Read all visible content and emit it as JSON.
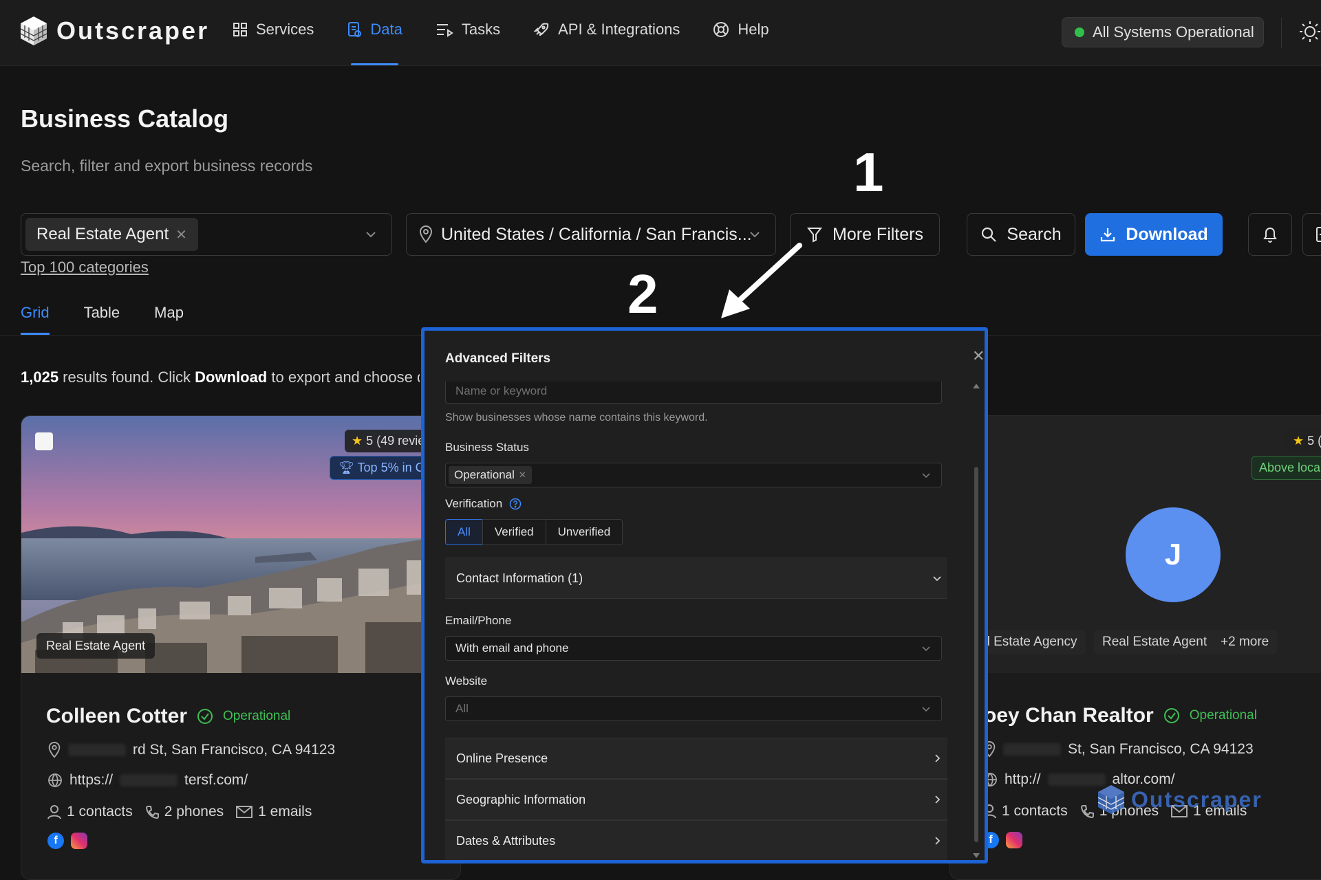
{
  "nav": {
    "brand": "Outscraper",
    "items": [
      {
        "label": "Services",
        "icon": "grid-icon"
      },
      {
        "label": "Data",
        "icon": "database-doc-icon",
        "active": true
      },
      {
        "label": "Tasks",
        "icon": "tasks-list-icon"
      },
      {
        "label": "API & Integrations",
        "icon": "rocket-icon"
      },
      {
        "label": "Help",
        "icon": "lifebuoy-icon"
      }
    ],
    "status": "All Systems Operational",
    "status_color": "#2fbf4a"
  },
  "header": {
    "title": "Business Catalog",
    "subtitle": "Search, filter and export business records"
  },
  "annotations": {
    "step1": "1",
    "step2": "2"
  },
  "filters": {
    "category_chip": "Real Estate Agent",
    "location": "United States / California / San Francis...",
    "more_filters": "More Filters",
    "search": "Search",
    "download": "Download",
    "top_categories": "Top 100 categories"
  },
  "tabs": [
    {
      "label": "Grid",
      "active": true
    },
    {
      "label": "Table"
    },
    {
      "label": "Map"
    }
  ],
  "results": {
    "count": "1,025",
    "text_a": " results found. Click ",
    "bold": "Download",
    "text_b": " to export and choose qu"
  },
  "cards": [
    {
      "rating": "5 (49 revie",
      "top_badge": "Top 5% in C",
      "image_tag": "Real Estate Agent",
      "name": "Colleen Cotter",
      "status": "Operational",
      "address": "rd St, San Francisco, CA 94123",
      "website_a": "https://",
      "website_b": "tersf.com/",
      "contacts": "1 contacts",
      "phones": "2 phones",
      "emails": "1 emails"
    },
    {
      "rating": "5 (",
      "top_badge": "Above loca",
      "avatar": "J",
      "categories": [
        "al Estate Agency",
        "Real Estate Agent",
        "+2 more"
      ],
      "name": "oey Chan Realtor",
      "status": "Operational",
      "address": "St, San Francisco, CA 94123",
      "website_a": "http://",
      "website_b": "altor.com/",
      "contacts": "1 contacts",
      "phones": "1 phones",
      "emails": "1 emails"
    }
  ],
  "watermark": "Outscraper",
  "modal": {
    "title": "Advanced Filters",
    "name_placeholder": "Name or keyword",
    "name_hint": "Show businesses whose name contains this keyword.",
    "status_label": "Business Status",
    "status_chip": "Operational",
    "verification_label": "Verification",
    "verification_options": [
      "All",
      "Verified",
      "Unverified"
    ],
    "verification_selected": "All",
    "contact_section": "Contact Information (1)",
    "email_phone_label": "Email/Phone",
    "email_phone_value": "With email and phone",
    "website_label": "Website",
    "website_value": "All",
    "sections": [
      "Online Presence",
      "Geographic Information",
      "Dates & Attributes"
    ]
  }
}
